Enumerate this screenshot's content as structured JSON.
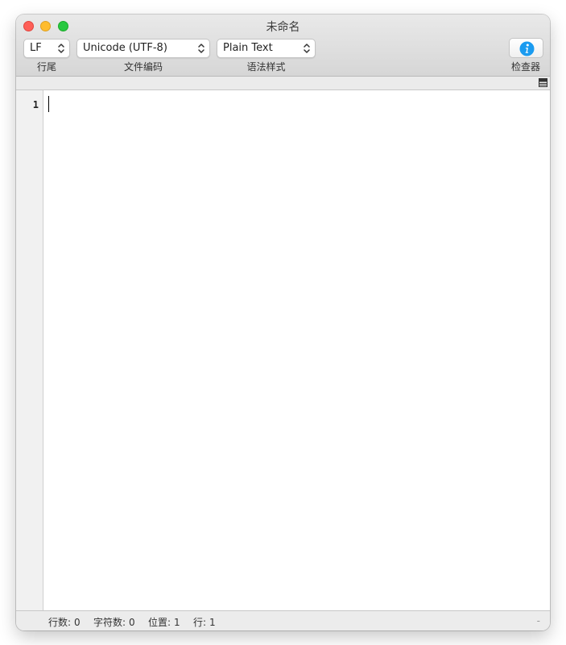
{
  "window": {
    "title": "未命名"
  },
  "toolbar": {
    "line_ending": {
      "value": "LF",
      "label": "行尾"
    },
    "encoding": {
      "value": "Unicode (UTF-8)",
      "label": "文件编码"
    },
    "syntax": {
      "value": "Plain Text",
      "label": "语法样式"
    },
    "inspector": {
      "label": "检查器",
      "icon": "info-icon"
    }
  },
  "editor": {
    "line_numbers": [
      "1"
    ],
    "content": ""
  },
  "status": {
    "lines": {
      "label": "行数:",
      "value": "0"
    },
    "chars": {
      "label": "字符数:",
      "value": "0"
    },
    "position": {
      "label": "位置:",
      "value": "1"
    },
    "row": {
      "label": "行:",
      "value": "1"
    },
    "trailing": "-"
  },
  "colors": {
    "close": "#fe5f57",
    "minimize": "#febc2e",
    "maximize": "#28c840",
    "info_accent": "#1a9bf0"
  }
}
